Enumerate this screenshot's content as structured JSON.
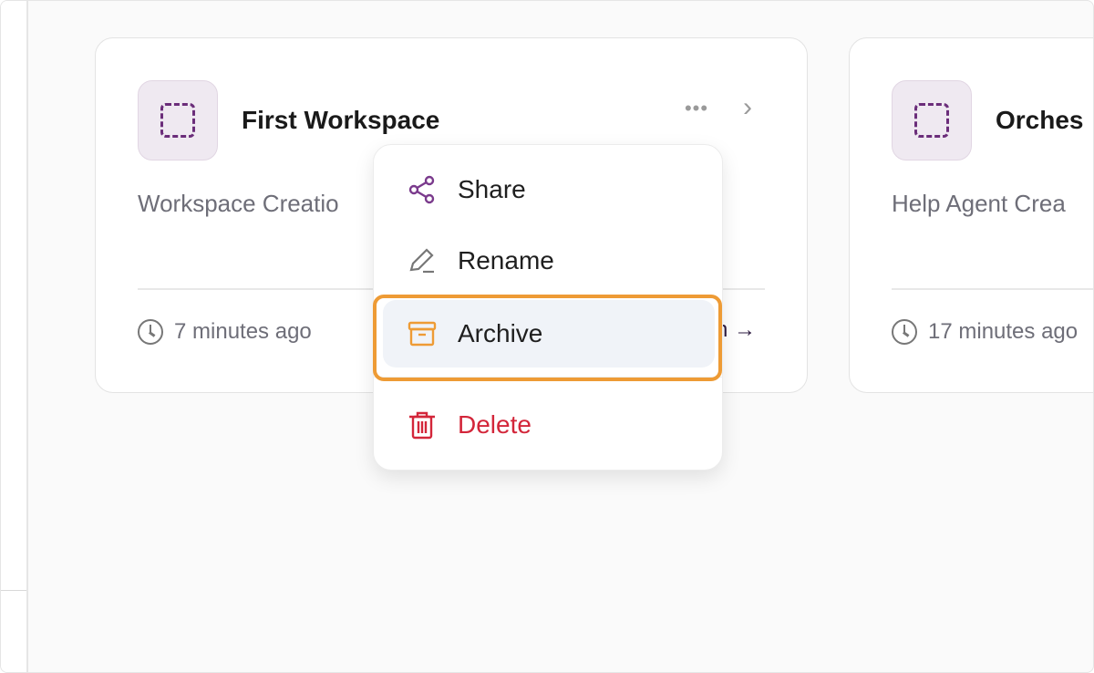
{
  "cards": [
    {
      "title": "First Workspace",
      "description": "Workspace Creatio",
      "time": "7 minutes ago",
      "open_label": "n →",
      "more_label": "•••",
      "chevron": "›"
    },
    {
      "title": "Orches",
      "description": "Help Agent Crea",
      "time": "17 minutes ago"
    }
  ],
  "menu": {
    "items": [
      {
        "label": "Share",
        "icon": "share-icon"
      },
      {
        "label": "Rename",
        "icon": "pencil-icon"
      },
      {
        "label": "Archive",
        "icon": "archive-icon"
      },
      {
        "label": "Delete",
        "icon": "trash-icon"
      }
    ]
  },
  "colors": {
    "accent_purple": "#6b2d7a",
    "archive_orange": "#ee9b35",
    "delete_red": "#d3263a",
    "highlight_border": "#ee9b35"
  }
}
